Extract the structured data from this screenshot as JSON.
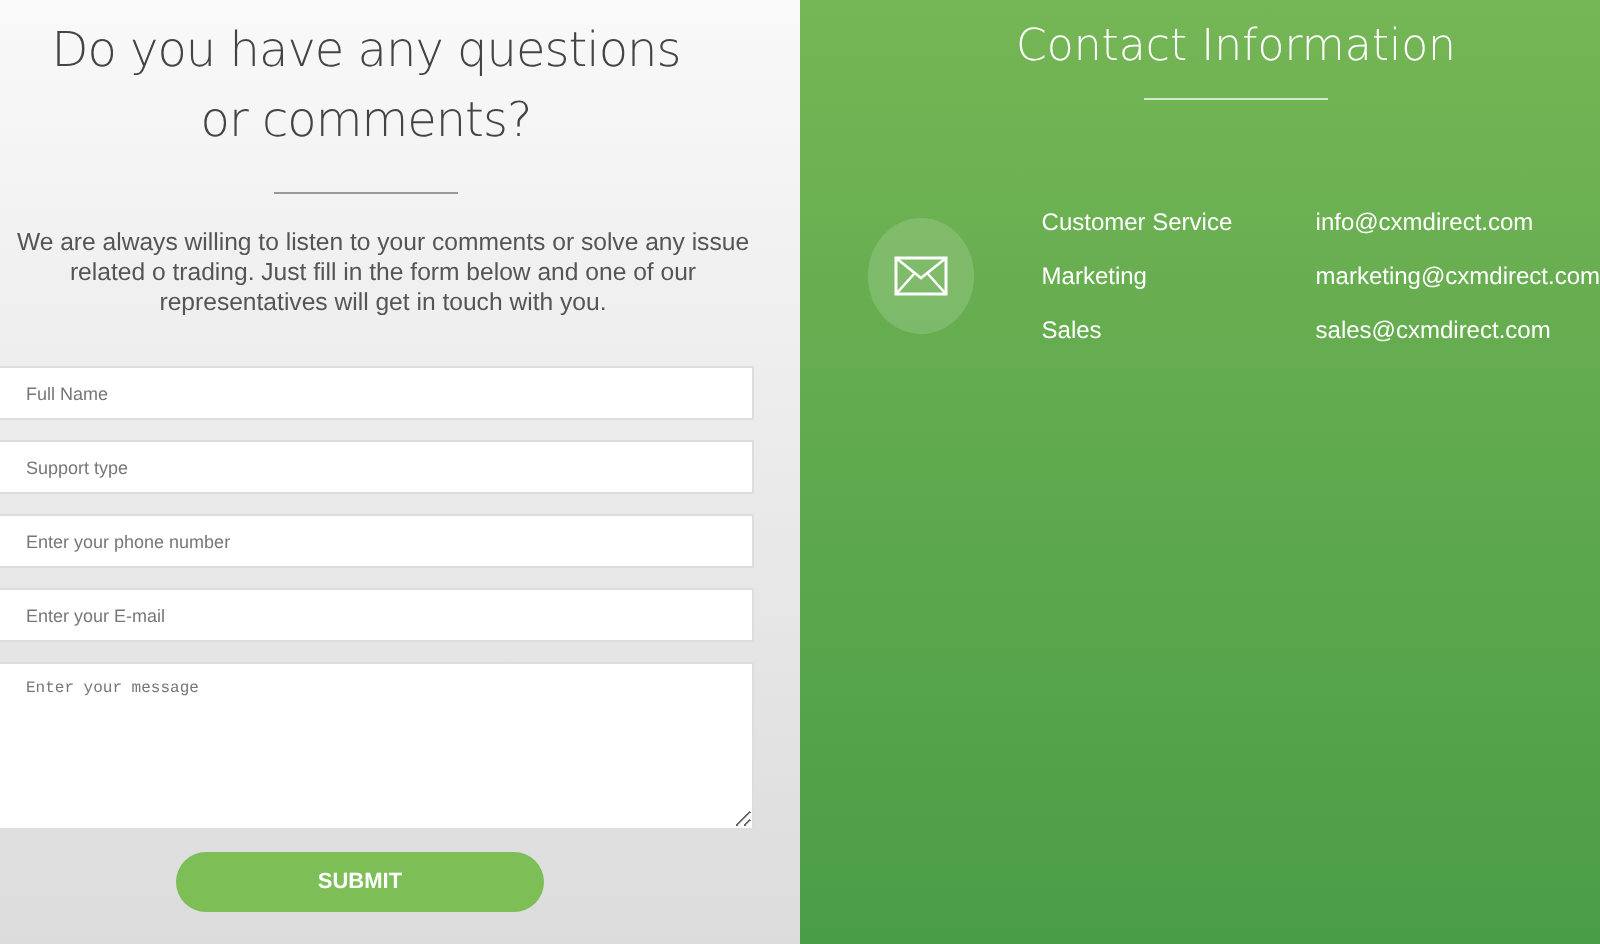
{
  "form_panel": {
    "title": "Do you have any questions or comments?",
    "intro": "We are always willing to listen to your comments or solve any issue related o trading. Just fill in the form below and one of our representatives will get in touch with you.",
    "fields": [
      {
        "placeholder": "Full Name",
        "kind": "input"
      },
      {
        "placeholder": "Support type",
        "kind": "input"
      },
      {
        "placeholder": "Enter your phone number",
        "kind": "input"
      },
      {
        "placeholder": "Enter your E-mail",
        "kind": "input"
      },
      {
        "placeholder": "Enter your message",
        "kind": "textarea"
      }
    ],
    "submit": "SUBMIT"
  },
  "contact_panel": {
    "title": "Contact Information",
    "contacts": [
      {
        "label": "Customer Service",
        "email": "info@cxmdirect.com"
      },
      {
        "label": "Marketing",
        "email": "marketing@cxmdirect.com"
      },
      {
        "label": "Sales",
        "email": "sales@cxmdirect.com"
      }
    ]
  }
}
